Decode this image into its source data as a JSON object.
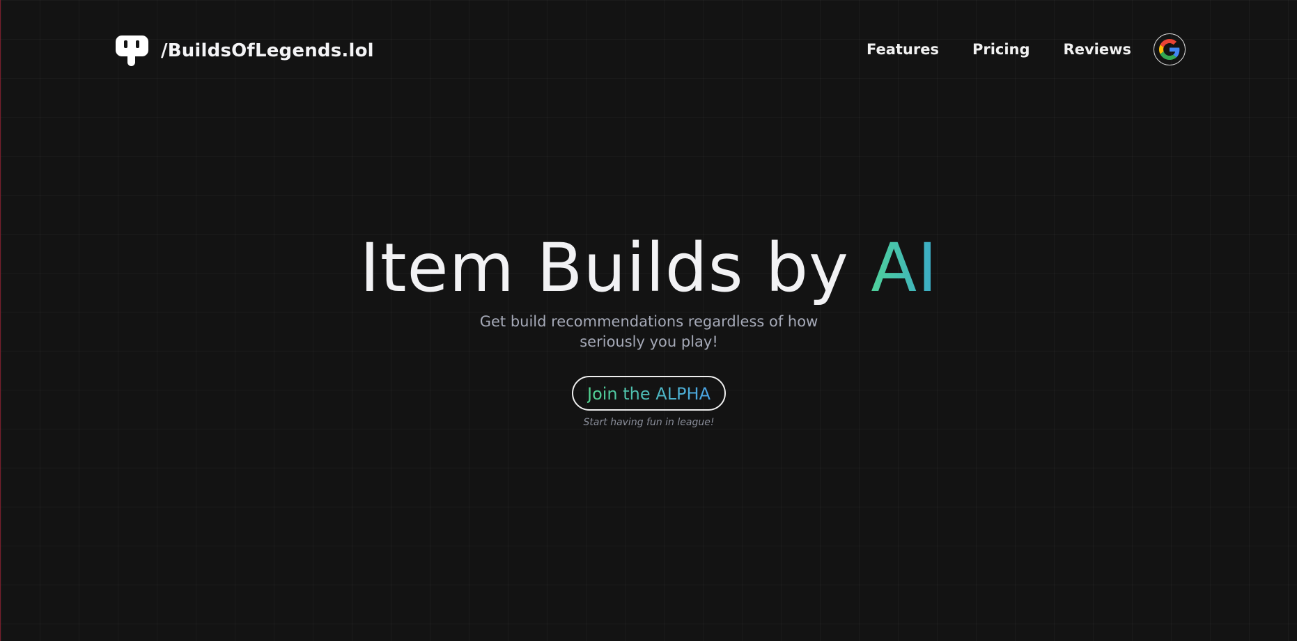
{
  "header": {
    "brand_name": "/BuildsOfLegends.lol",
    "logo_icon": "plug-icon",
    "nav": [
      {
        "label": "Features"
      },
      {
        "label": "Pricing"
      },
      {
        "label": "Reviews"
      }
    ],
    "google_icon": "google-icon"
  },
  "hero": {
    "title_main": "Item Builds by ",
    "title_accent": "AI",
    "subtitle": "Get build recommendations regardless of how seriously you play!",
    "cta_label": "Join the ALPHA",
    "cta_note": "Start having fun in league!"
  },
  "colors": {
    "background": "#131313",
    "accent_start": "#4fd19a",
    "accent_end": "#3aa9c9",
    "text": "#f2f2f4",
    "muted": "#a6aab8"
  }
}
